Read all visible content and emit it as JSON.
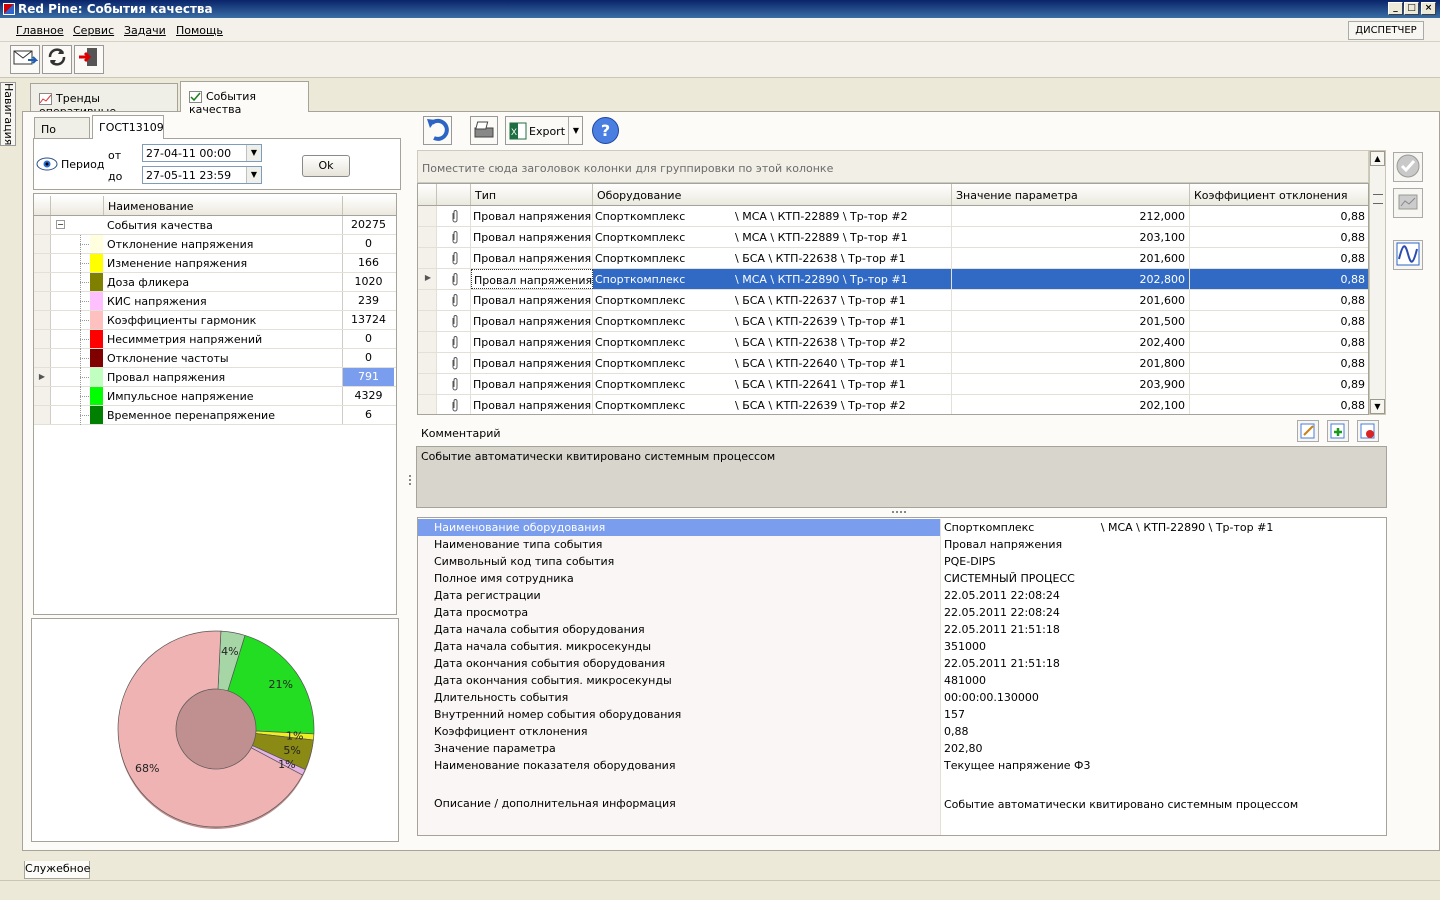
{
  "window": {
    "title": "Red Pine: События качества"
  },
  "menu": {
    "items": [
      "Главное",
      "Сервис",
      "Задачи",
      "Помощь"
    ],
    "dispatcher": "ДИСПЕТЧЕР"
  },
  "nav": {
    "label": "Навигация"
  },
  "tabs": [
    {
      "label": "Тренды оперативные"
    },
    {
      "label": "События качества"
    }
  ],
  "left": {
    "subtabs": [
      "По дате",
      "ГОСТ13109"
    ],
    "period_label": "Период",
    "from_label": "от",
    "to_label": "до",
    "from_value": "27-04-11 00:00",
    "to_value": "27-05-11 23:59",
    "ok": "Ok",
    "tree_header": "Наименование",
    "root": {
      "name": "События качества",
      "value": "20275"
    },
    "items": [
      {
        "name": "Отклонение напряжения",
        "value": "0",
        "color": "#ffffe0"
      },
      {
        "name": "Изменение напряжения",
        "value": "166",
        "color": "#ffff00"
      },
      {
        "name": "Доза фликера",
        "value": "1020",
        "color": "#808000"
      },
      {
        "name": "КИС напряжения",
        "value": "239",
        "color": "#ffc0ff"
      },
      {
        "name": "Коэффициенты гармоник",
        "value": "13724",
        "color": "#ffc0c0"
      },
      {
        "name": "Несимметрия напряжений",
        "value": "0",
        "color": "#ff0000"
      },
      {
        "name": "Отклонение частоты",
        "value": "0",
        "color": "#800000"
      },
      {
        "name": "Провал напряжения",
        "value": "791",
        "color": "#c0ffc0"
      },
      {
        "name": "Импульсное напряжение",
        "value": "4329",
        "color": "#00ff00"
      },
      {
        "name": "Временное перенапряжение",
        "value": "6",
        "color": "#008000"
      }
    ]
  },
  "chart_data": {
    "type": "pie",
    "categories": [
      "Провал напряжения",
      "Импульсное напряжение",
      "Изменение напряжения",
      "Доза фликера",
      "КИС напряжения",
      "Коэффициенты гармоник"
    ],
    "values": [
      4,
      21,
      1,
      5,
      1,
      68
    ],
    "labels": [
      "4%",
      "21%",
      "1%",
      "5%",
      "1%",
      "68%"
    ],
    "colors": [
      "#a6d6a6",
      "#22dd22",
      "#eeee22",
      "#8a8a14",
      "#e6b3e6",
      "#f0b3b3"
    ]
  },
  "right": {
    "export": "Export",
    "group_hint": "Поместите сюда заголовок колонки для группировки по этой колонке",
    "columns": [
      "Тип",
      "Оборудование",
      "Значение параметра",
      "Коэффициент отклонения"
    ],
    "rows": [
      {
        "type": "Провал напряжения",
        "org": "Спорткомплекс",
        "path": "\\ МСА \\ КТП-22889 \\ Тр-тор #2",
        "value": "212,000",
        "coef": "0,88"
      },
      {
        "type": "Провал напряжения",
        "org": "Спорткомплекс",
        "path": "\\ МСА \\ КТП-22889 \\ Тр-тор #1",
        "value": "203,100",
        "coef": "0,88"
      },
      {
        "type": "Провал напряжения",
        "org": "Спорткомплекс",
        "path": "\\ БСА \\ КТП-22638 \\ Тр-тор #1",
        "value": "201,600",
        "coef": "0,88"
      },
      {
        "type": "Провал напряжения",
        "org": "Спорткомплекс",
        "path": "\\ МСА \\ КТП-22890 \\ Тр-тор #1",
        "value": "202,800",
        "coef": "0,88"
      },
      {
        "type": "Провал напряжения",
        "org": "Спорткомплекс",
        "path": "\\ БСА \\ КТП-22637 \\ Тр-тор #1",
        "value": "201,600",
        "coef": "0,88"
      },
      {
        "type": "Провал напряжения",
        "org": "Спорткомплекс",
        "path": "\\ БСА \\ КТП-22639 \\ Тр-тор #1",
        "value": "201,500",
        "coef": "0,88"
      },
      {
        "type": "Провал напряжения",
        "org": "Спорткомплекс",
        "path": "\\ БСА \\ КТП-22638 \\ Тр-тор #2",
        "value": "202,400",
        "coef": "0,88"
      },
      {
        "type": "Провал напряжения",
        "org": "Спорткомплекс",
        "path": "\\ БСА \\ КТП-22640 \\ Тр-тор #1",
        "value": "201,800",
        "coef": "0,88"
      },
      {
        "type": "Провал напряжения",
        "org": "Спорткомплекс",
        "path": "\\ БСА \\ КТП-22641 \\ Тр-тор #1",
        "value": "203,900",
        "coef": "0,89"
      },
      {
        "type": "Провал напряжения",
        "org": "Спорткомплекс",
        "path": "\\ БСА \\ КТП-22639 \\ Тр-тор #2",
        "value": "202,100",
        "coef": "0,88"
      }
    ],
    "comment_label": "Комментарий",
    "comment_text": "Событие автоматически квитировано системным процессом",
    "properties": [
      {
        "label": "Наименование оборудования",
        "value": "Спорткомплекс                   \\ МСА \\ КТП-22890 \\ Тр-тор #1"
      },
      {
        "label": "Наименование типа события",
        "value": "Провал напряжения"
      },
      {
        "label": "Символьный код типа события",
        "value": "PQE-DIPS"
      },
      {
        "label": "Полное имя сотрудника",
        "value": "СИСТЕМНЫЙ ПРОЦЕСС"
      },
      {
        "label": "Дата регистрации",
        "value": "22.05.2011 22:08:24"
      },
      {
        "label": "Дата просмотра",
        "value": "22.05.2011 22:08:24"
      },
      {
        "label": "Дата начала события оборудования",
        "value": "22.05.2011 21:51:18"
      },
      {
        "label": "Дата начала события. микросекунды",
        "value": "351000"
      },
      {
        "label": "Дата окончания события оборудования",
        "value": "22.05.2011 21:51:18"
      },
      {
        "label": "Дата окончания события. микросекунды",
        "value": "481000"
      },
      {
        "label": "Длительность события",
        "value": "00:00:00.130000"
      },
      {
        "label": "Внутренний номер события оборудования",
        "value": "157"
      },
      {
        "label": "Коэффициент отклонения",
        "value": "0,88"
      },
      {
        "label": "Значение параметра",
        "value": "202,80"
      },
      {
        "label": "Наименование показателя оборудования",
        "value": "Текущее напряжение Ф3"
      }
    ],
    "description_label": "Описание / дополнительная информация",
    "description_value": "Событие автоматически квитировано системным процессом"
  },
  "bottom_tab": "Служебное"
}
